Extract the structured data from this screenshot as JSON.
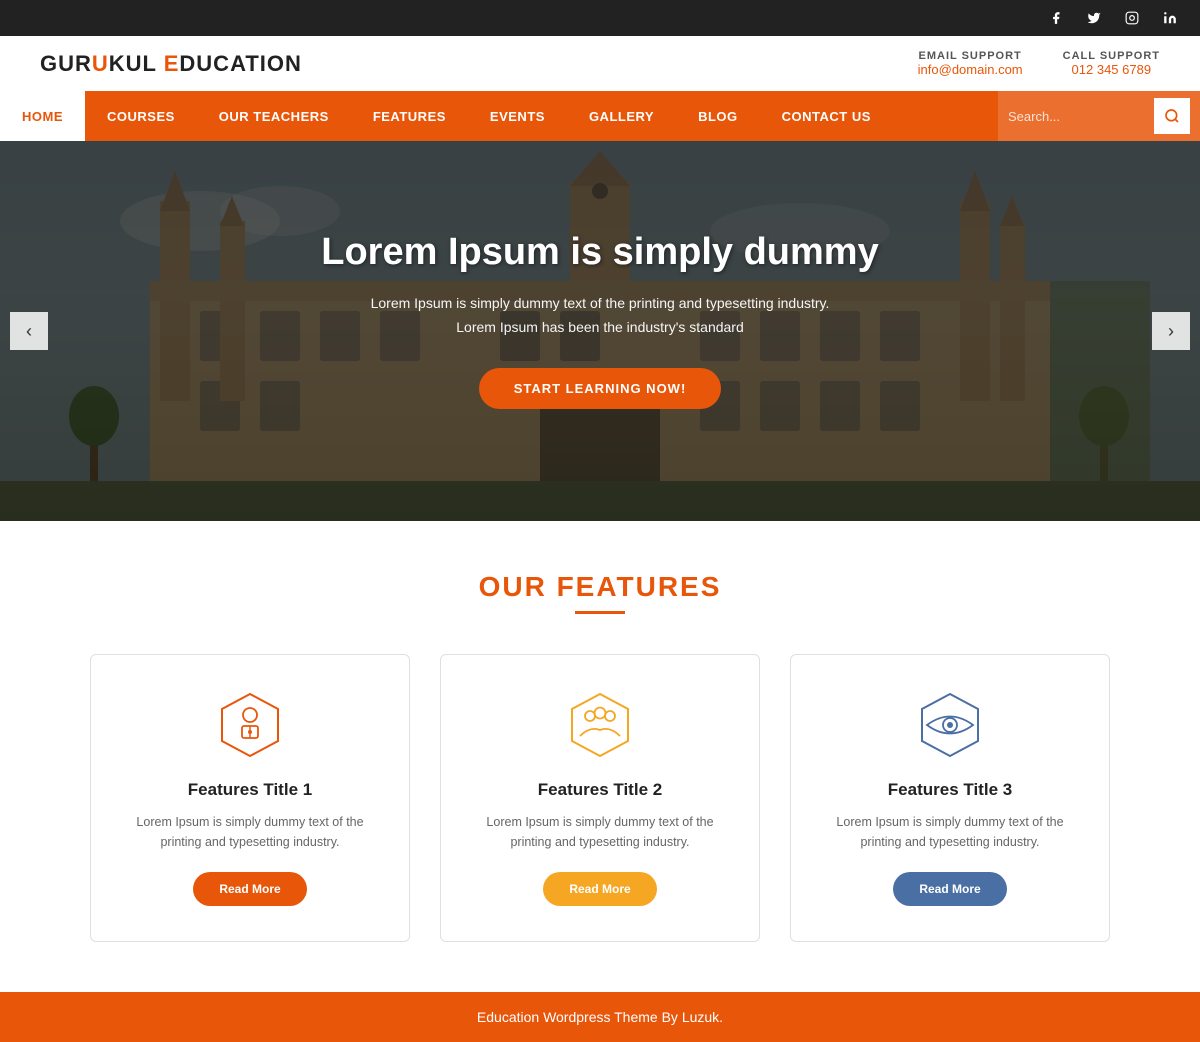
{
  "topbar": {
    "social": [
      "facebook-icon",
      "twitter-icon",
      "instagram-icon",
      "linkedin-icon"
    ]
  },
  "header": {
    "logo_text": "GURUKUL",
    "logo_highlight": "U",
    "logo_suffix": " EDUCATION",
    "email_label": "EMAIL SUPPORT",
    "email_value": "info@domain.com",
    "phone_label": "CALL SUPPORT",
    "phone_value": "012 345 6789"
  },
  "nav": {
    "items": [
      {
        "label": "HOME",
        "active": true
      },
      {
        "label": "COURSES",
        "active": false
      },
      {
        "label": "OUR TEACHERS",
        "active": false
      },
      {
        "label": "FEATURES",
        "active": false
      },
      {
        "label": "EVENTS",
        "active": false
      },
      {
        "label": "GALLERY",
        "active": false
      },
      {
        "label": "BLOG",
        "active": false
      },
      {
        "label": "CONTACT US",
        "active": false
      }
    ],
    "search_placeholder": "Search..."
  },
  "hero": {
    "title": "Lorem Ipsum is simply dummy",
    "subtitle_line1": "Lorem Ipsum is simply dummy text of the printing and typesetting industry.",
    "subtitle_line2": "Lorem Ipsum has been the industry's standard",
    "cta_button": "START LEARNING NOW!",
    "arrow_left": "‹",
    "arrow_right": "›"
  },
  "features": {
    "section_title": "OUR FEATURES",
    "cards": [
      {
        "title": "Features Title 1",
        "text": "Lorem Ipsum is simply dummy text of the printing and typesetting industry.",
        "button_label": "Read More",
        "btn_class": "btn-orange",
        "icon_color": "#e8560a"
      },
      {
        "title": "Features Title 2",
        "text": "Lorem Ipsum is simply dummy text of the printing and typesetting industry.",
        "button_label": "Read More",
        "btn_class": "btn-yellow",
        "icon_color": "#f5a623"
      },
      {
        "title": "Features Title 3",
        "text": "Lorem Ipsum is simply dummy text of the printing and typesetting industry.",
        "button_label": "Read More",
        "btn_class": "btn-blue",
        "icon_color": "#4a6fa5"
      }
    ]
  },
  "footer": {
    "text": "Education Wordpress Theme By Luzuk."
  }
}
